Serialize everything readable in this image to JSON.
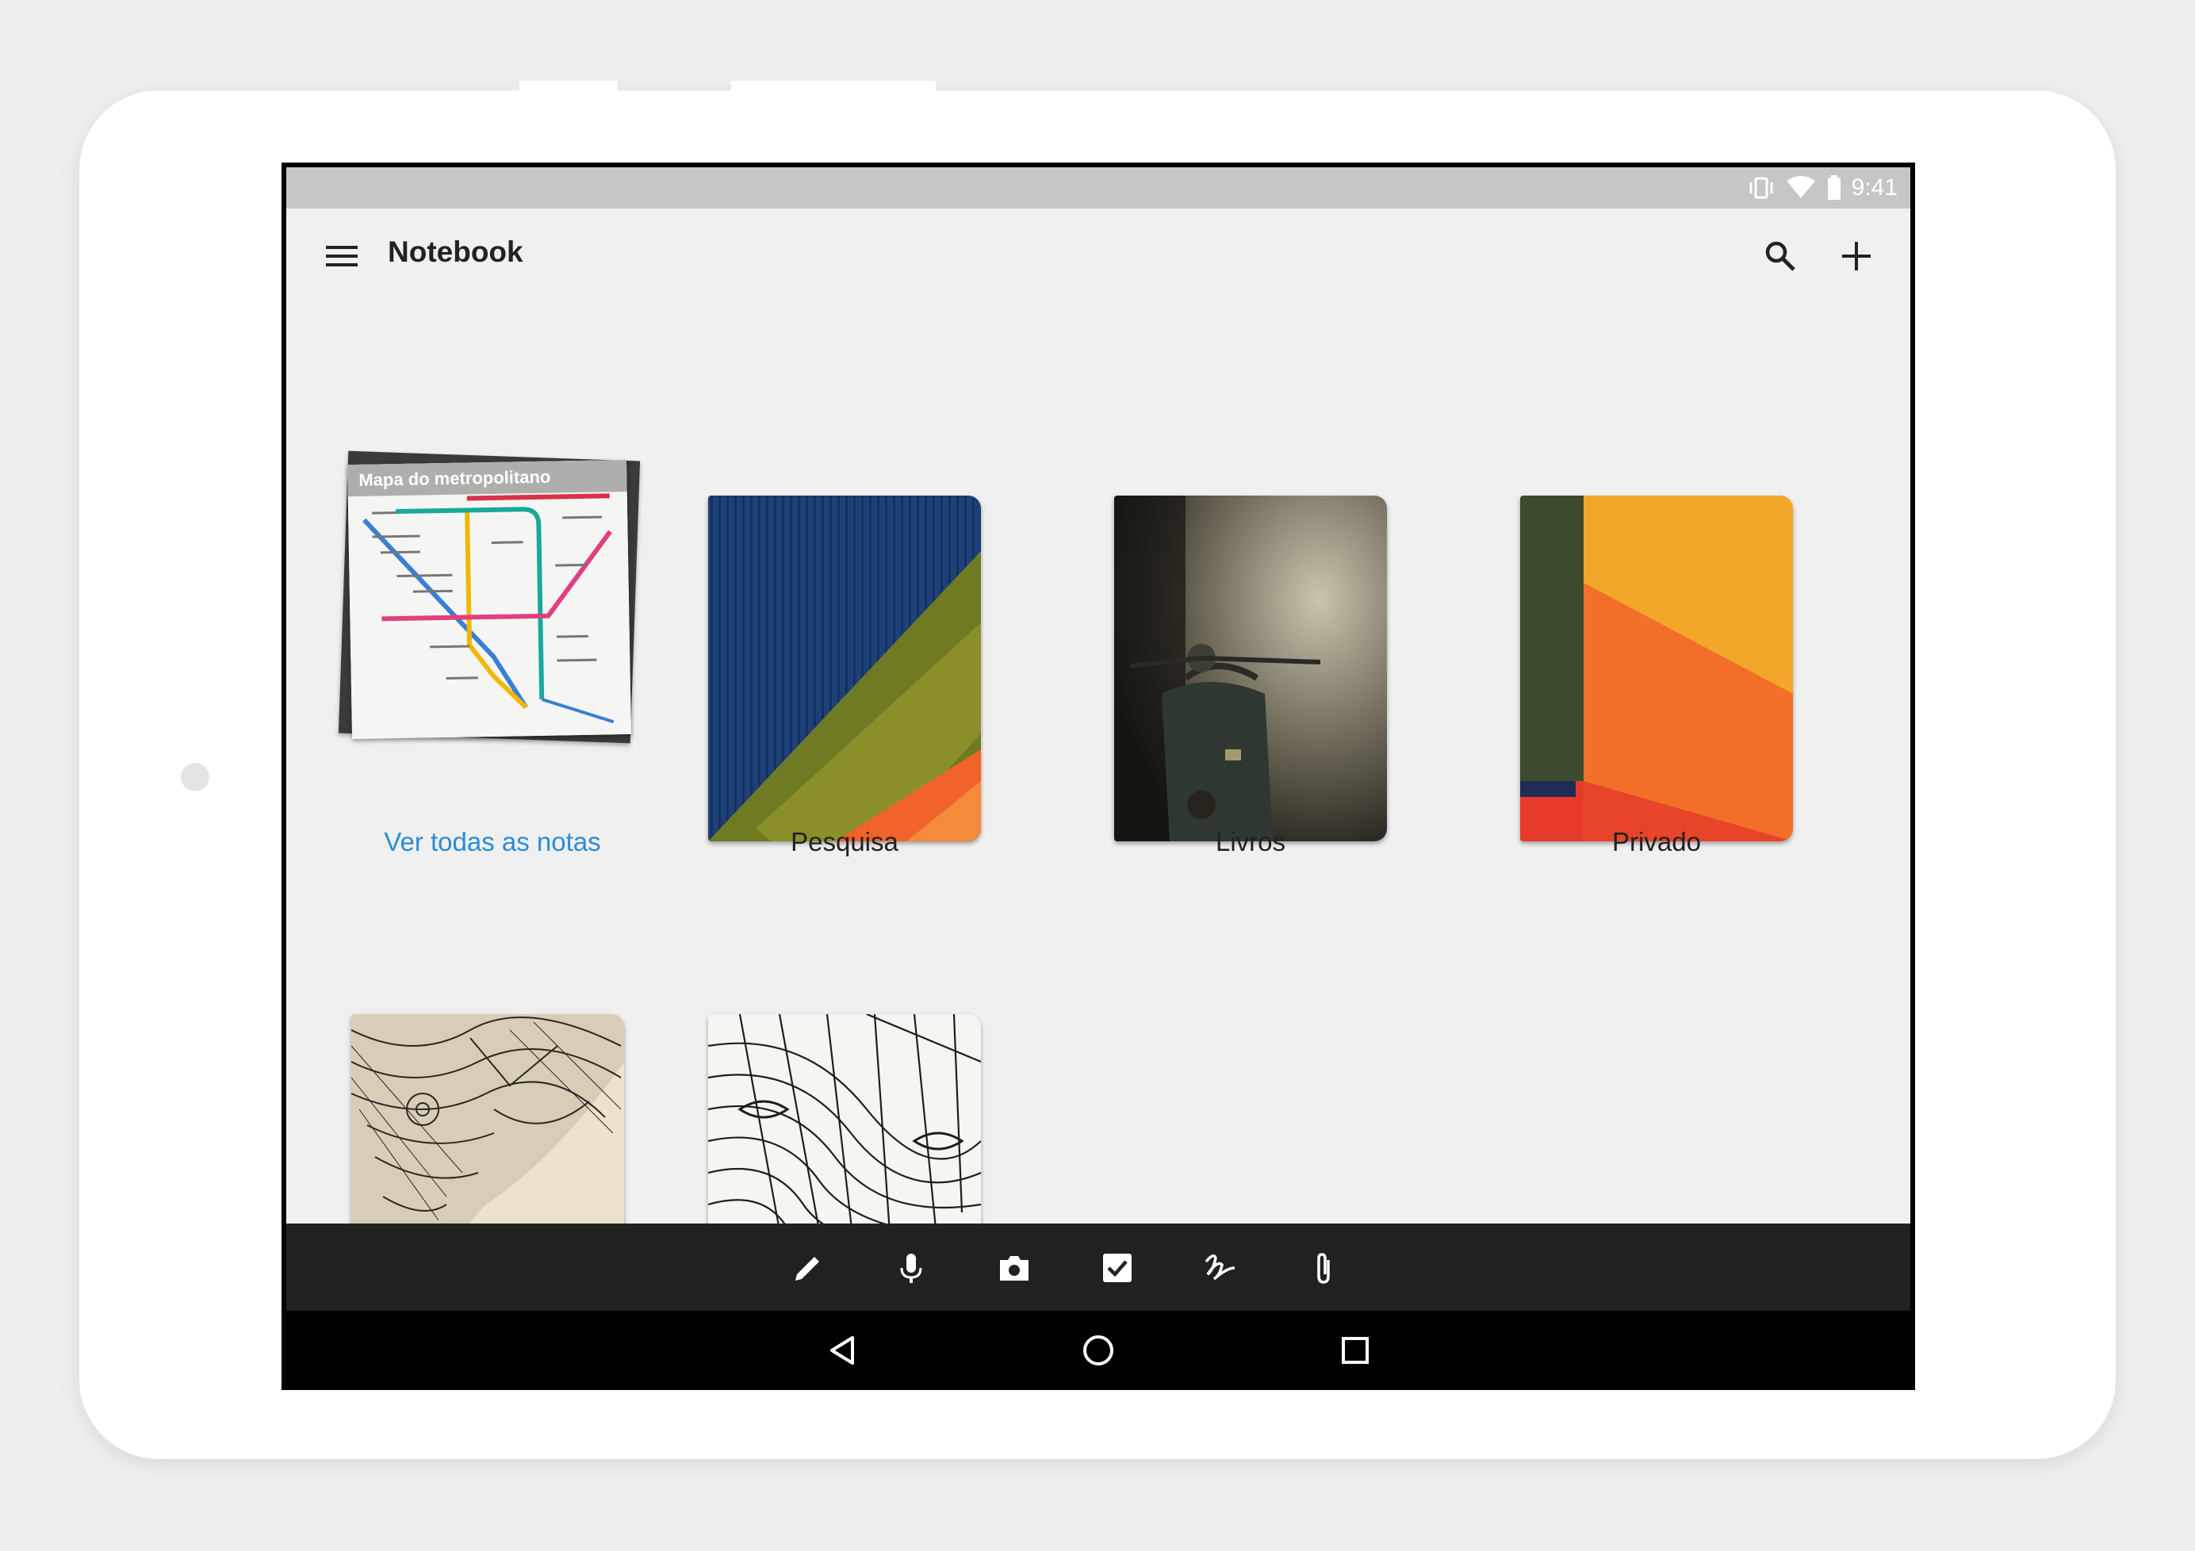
{
  "status_bar": {
    "time": "9:41",
    "icons": [
      "vibrate-icon",
      "wifi-icon",
      "battery-icon"
    ]
  },
  "app_bar": {
    "title": "Notebook",
    "icons": [
      "menu-icon",
      "search-icon",
      "add-icon"
    ]
  },
  "notebooks": [
    {
      "label": "Ver todas as notas",
      "cover": "metro-map-stack",
      "preview_title": "Mapa do metropolitano",
      "is_link": true
    },
    {
      "label": "Pesquisa",
      "cover": "blue-green-orange-abstract"
    },
    {
      "label": "Livros",
      "cover": "vintage-scooter"
    },
    {
      "label": "Privado",
      "cover": "orange-yellow-abstract"
    },
    {
      "label": "",
      "cover": "elephant-zentangle"
    },
    {
      "label": "",
      "cover": "line-pattern"
    }
  ],
  "bottom_toolbar": [
    "pencil-icon",
    "microphone-icon",
    "camera-icon",
    "checkbox-icon",
    "handwriting-icon",
    "attachment-icon"
  ],
  "nav_bar": [
    "back-icon",
    "home-icon",
    "recents-icon"
  ],
  "colors": {
    "link": "#2b8bd6",
    "status_bar": "#c6c6c6",
    "toolbar": "#212121",
    "background": "#f0f0f0"
  }
}
